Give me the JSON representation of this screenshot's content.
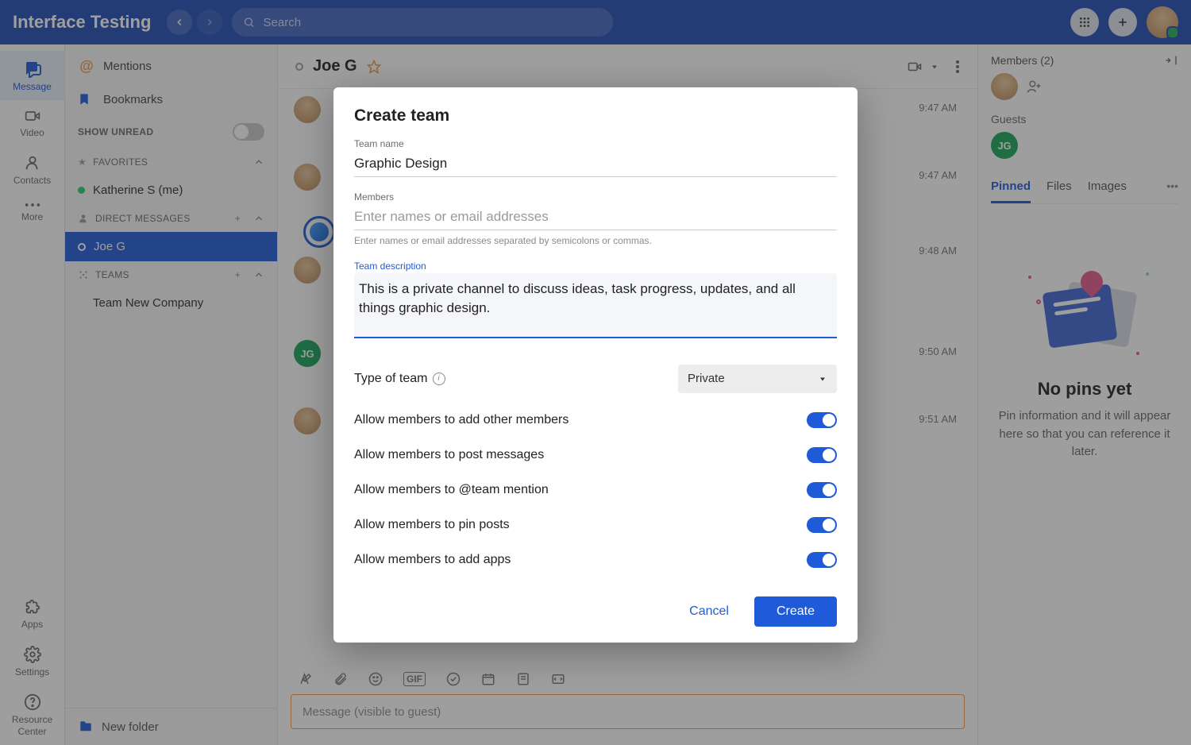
{
  "header": {
    "app_title": "Interface Testing",
    "search_placeholder": "Search"
  },
  "rail": {
    "message": "Message",
    "video": "Video",
    "contacts": "Contacts",
    "more": "More",
    "apps": "Apps",
    "settings": "Settings",
    "resource1": "Resource",
    "resource2": "Center"
  },
  "sidebar": {
    "mentions": "Mentions",
    "bookmarks": "Bookmarks",
    "show_unread": "SHOW UNREAD",
    "favorites": "FAVORITES",
    "fav_item": "Katherine S (me)",
    "dm_header": "DIRECT MESSAGES",
    "dm_item": "Joe G",
    "teams_header": "TEAMS",
    "teams_item": "Team New Company",
    "new_folder": "New folder"
  },
  "conv": {
    "title": "Joe G",
    "times": [
      "9:47 AM",
      "9:47 AM",
      "9:48 AM",
      "9:50 AM",
      "9:51 AM"
    ],
    "jg": "JG",
    "composer_placeholder": "Message (visible to guest)"
  },
  "rpanel": {
    "members": "Members (2)",
    "guests": "Guests",
    "jg": "JG",
    "tabs": {
      "pinned": "Pinned",
      "files": "Files",
      "images": "Images"
    },
    "empty_title": "No pins yet",
    "empty_body": "Pin information and it will appear here so that you can reference it later."
  },
  "modal": {
    "title": "Create team",
    "team_name_label": "Team name",
    "team_name_value": "Graphic Design",
    "members_label": "Members",
    "members_placeholder": "Enter names or email addresses",
    "members_help": "Enter names or email addresses separated by semicolons or commas.",
    "desc_label": "Team description",
    "desc_value": "This is a private channel to discuss ideas, task progress, updates, and all things graphic design.",
    "type_label": "Type of team",
    "type_value": "Private",
    "opts": {
      "add_members": "Allow members to add other members",
      "post": "Allow members to post messages",
      "mention": "Allow members to @team mention",
      "pin": "Allow members to pin posts",
      "apps": "Allow members to add apps"
    },
    "cancel": "Cancel",
    "create": "Create"
  }
}
